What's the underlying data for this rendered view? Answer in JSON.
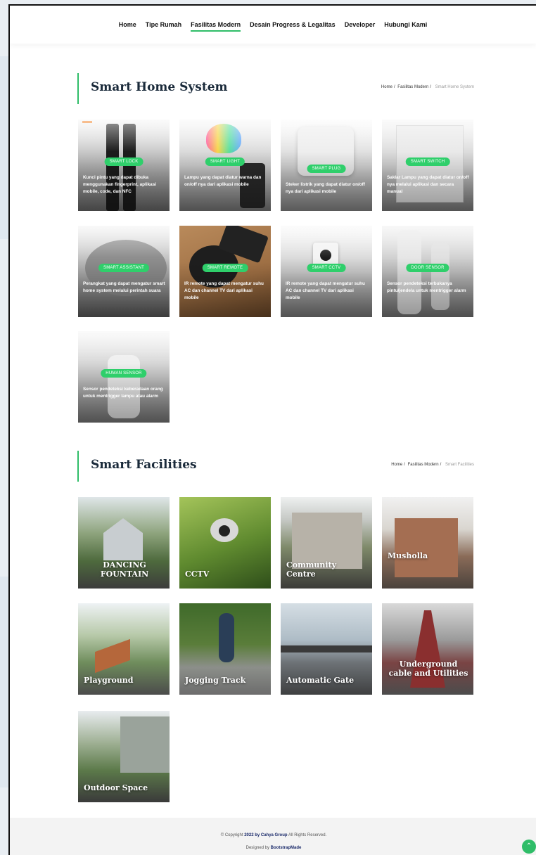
{
  "nav": {
    "items": [
      {
        "label": "Home"
      },
      {
        "label": "Tipe Rumah"
      },
      {
        "label": "Fasilitas Modern",
        "active": true
      },
      {
        "label": "Desain Progress & Legalitas"
      },
      {
        "label": "Developer"
      },
      {
        "label": "Hubungi Kami"
      }
    ]
  },
  "smart_home": {
    "title": "Smart Home System",
    "breadcrumb": [
      "Home",
      "Fasilitas Modern",
      "Smart Home System"
    ],
    "cards": [
      {
        "badge": "SMART LOCK",
        "desc": "Kunci pintu yang dapat dibuka menggunakan fingerprint, aplikasi mobile, code, dan NFC"
      },
      {
        "badge": "SMART LIGHT",
        "desc": "Lampu yang dapat diatur warna dan on/off nya dari aplikasi mobile"
      },
      {
        "badge": "SMART PLUG",
        "desc": "Steker listrik yang dapat diatur on/off nya dari aplikasi mobile"
      },
      {
        "badge": "SMART SWITCH",
        "desc": "Saklar Lampu yang dapat diatur on/off nya melalui aplikasi dan secara manual"
      },
      {
        "badge": "SMART ASSISTANT",
        "desc": "Perangkat yang dapat mengatur smart home system melalui perintah suara"
      },
      {
        "badge": "SMART REMOTE",
        "desc": "IR remote yang dapat mengatur suhu AC dan channel TV dari aplikasi mobile"
      },
      {
        "badge": "SMART CCTV",
        "desc": "IR remote yang dapat mengatur suhu AC dan channel TV dari aplikasi mobile"
      },
      {
        "badge": "DOOR SENSOR",
        "desc": "Sensor pendeteksi terbukanya pintu/jendela untuk mentrigger alarm"
      },
      {
        "badge": "HUMAN SENSOR",
        "desc": "Sensor pendeteksi keberadaan orang untuk mentrigger lampu atau alarm"
      }
    ]
  },
  "smart_facilities": {
    "title": "Smart Facilities",
    "breadcrumb": [
      "Home",
      "Fasilitas Modern",
      "Smart Facilities"
    ],
    "cards": [
      {
        "label": "DANCING FOUNTAIN"
      },
      {
        "label": "CCTV"
      },
      {
        "label": "Community Centre"
      },
      {
        "label": "Musholla"
      },
      {
        "label": "Playground"
      },
      {
        "label": "Jogging Track"
      },
      {
        "label": "Automatic Gate"
      },
      {
        "label": "Underground cable and Utilities"
      },
      {
        "label": "Outdoor Space"
      }
    ]
  },
  "footer": {
    "copyright_prefix": "© Copyright",
    "company": "2022 by Cahya Group",
    "rights": "All Rights Reserved.",
    "designed_prefix": "Designed by",
    "designer": "BootstrapMade"
  },
  "colors": {
    "accent": "#2fbd68",
    "badge": "#2fcf6b"
  },
  "icons": {
    "back_to_top": "arrow-up-icon"
  }
}
